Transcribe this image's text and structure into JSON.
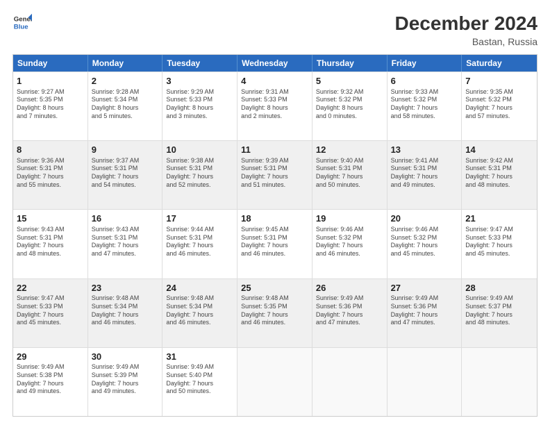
{
  "header": {
    "logo_line1": "General",
    "logo_line2": "Blue",
    "month": "December 2024",
    "location": "Bastan, Russia"
  },
  "weekdays": [
    "Sunday",
    "Monday",
    "Tuesday",
    "Wednesday",
    "Thursday",
    "Friday",
    "Saturday"
  ],
  "rows": [
    [
      {
        "day": "1",
        "lines": [
          "Sunrise: 9:27 AM",
          "Sunset: 5:35 PM",
          "Daylight: 8 hours",
          "and 7 minutes."
        ],
        "shade": false
      },
      {
        "day": "2",
        "lines": [
          "Sunrise: 9:28 AM",
          "Sunset: 5:34 PM",
          "Daylight: 8 hours",
          "and 5 minutes."
        ],
        "shade": false
      },
      {
        "day": "3",
        "lines": [
          "Sunrise: 9:29 AM",
          "Sunset: 5:33 PM",
          "Daylight: 8 hours",
          "and 3 minutes."
        ],
        "shade": false
      },
      {
        "day": "4",
        "lines": [
          "Sunrise: 9:31 AM",
          "Sunset: 5:33 PM",
          "Daylight: 8 hours",
          "and 2 minutes."
        ],
        "shade": false
      },
      {
        "day": "5",
        "lines": [
          "Sunrise: 9:32 AM",
          "Sunset: 5:32 PM",
          "Daylight: 8 hours",
          "and 0 minutes."
        ],
        "shade": false
      },
      {
        "day": "6",
        "lines": [
          "Sunrise: 9:33 AM",
          "Sunset: 5:32 PM",
          "Daylight: 7 hours",
          "and 58 minutes."
        ],
        "shade": false
      },
      {
        "day": "7",
        "lines": [
          "Sunrise: 9:35 AM",
          "Sunset: 5:32 PM",
          "Daylight: 7 hours",
          "and 57 minutes."
        ],
        "shade": false
      }
    ],
    [
      {
        "day": "8",
        "lines": [
          "Sunrise: 9:36 AM",
          "Sunset: 5:31 PM",
          "Daylight: 7 hours",
          "and 55 minutes."
        ],
        "shade": true
      },
      {
        "day": "9",
        "lines": [
          "Sunrise: 9:37 AM",
          "Sunset: 5:31 PM",
          "Daylight: 7 hours",
          "and 54 minutes."
        ],
        "shade": true
      },
      {
        "day": "10",
        "lines": [
          "Sunrise: 9:38 AM",
          "Sunset: 5:31 PM",
          "Daylight: 7 hours",
          "and 52 minutes."
        ],
        "shade": true
      },
      {
        "day": "11",
        "lines": [
          "Sunrise: 9:39 AM",
          "Sunset: 5:31 PM",
          "Daylight: 7 hours",
          "and 51 minutes."
        ],
        "shade": true
      },
      {
        "day": "12",
        "lines": [
          "Sunrise: 9:40 AM",
          "Sunset: 5:31 PM",
          "Daylight: 7 hours",
          "and 50 minutes."
        ],
        "shade": true
      },
      {
        "day": "13",
        "lines": [
          "Sunrise: 9:41 AM",
          "Sunset: 5:31 PM",
          "Daylight: 7 hours",
          "and 49 minutes."
        ],
        "shade": true
      },
      {
        "day": "14",
        "lines": [
          "Sunrise: 9:42 AM",
          "Sunset: 5:31 PM",
          "Daylight: 7 hours",
          "and 48 minutes."
        ],
        "shade": true
      }
    ],
    [
      {
        "day": "15",
        "lines": [
          "Sunrise: 9:43 AM",
          "Sunset: 5:31 PM",
          "Daylight: 7 hours",
          "and 48 minutes."
        ],
        "shade": false
      },
      {
        "day": "16",
        "lines": [
          "Sunrise: 9:43 AM",
          "Sunset: 5:31 PM",
          "Daylight: 7 hours",
          "and 47 minutes."
        ],
        "shade": false
      },
      {
        "day": "17",
        "lines": [
          "Sunrise: 9:44 AM",
          "Sunset: 5:31 PM",
          "Daylight: 7 hours",
          "and 46 minutes."
        ],
        "shade": false
      },
      {
        "day": "18",
        "lines": [
          "Sunrise: 9:45 AM",
          "Sunset: 5:31 PM",
          "Daylight: 7 hours",
          "and 46 minutes."
        ],
        "shade": false
      },
      {
        "day": "19",
        "lines": [
          "Sunrise: 9:46 AM",
          "Sunset: 5:32 PM",
          "Daylight: 7 hours",
          "and 46 minutes."
        ],
        "shade": false
      },
      {
        "day": "20",
        "lines": [
          "Sunrise: 9:46 AM",
          "Sunset: 5:32 PM",
          "Daylight: 7 hours",
          "and 45 minutes."
        ],
        "shade": false
      },
      {
        "day": "21",
        "lines": [
          "Sunrise: 9:47 AM",
          "Sunset: 5:33 PM",
          "Daylight: 7 hours",
          "and 45 minutes."
        ],
        "shade": false
      }
    ],
    [
      {
        "day": "22",
        "lines": [
          "Sunrise: 9:47 AM",
          "Sunset: 5:33 PM",
          "Daylight: 7 hours",
          "and 45 minutes."
        ],
        "shade": true
      },
      {
        "day": "23",
        "lines": [
          "Sunrise: 9:48 AM",
          "Sunset: 5:34 PM",
          "Daylight: 7 hours",
          "and 46 minutes."
        ],
        "shade": true
      },
      {
        "day": "24",
        "lines": [
          "Sunrise: 9:48 AM",
          "Sunset: 5:34 PM",
          "Daylight: 7 hours",
          "and 46 minutes."
        ],
        "shade": true
      },
      {
        "day": "25",
        "lines": [
          "Sunrise: 9:48 AM",
          "Sunset: 5:35 PM",
          "Daylight: 7 hours",
          "and 46 minutes."
        ],
        "shade": true
      },
      {
        "day": "26",
        "lines": [
          "Sunrise: 9:49 AM",
          "Sunset: 5:36 PM",
          "Daylight: 7 hours",
          "and 47 minutes."
        ],
        "shade": true
      },
      {
        "day": "27",
        "lines": [
          "Sunrise: 9:49 AM",
          "Sunset: 5:36 PM",
          "Daylight: 7 hours",
          "and 47 minutes."
        ],
        "shade": true
      },
      {
        "day": "28",
        "lines": [
          "Sunrise: 9:49 AM",
          "Sunset: 5:37 PM",
          "Daylight: 7 hours",
          "and 48 minutes."
        ],
        "shade": true
      }
    ],
    [
      {
        "day": "29",
        "lines": [
          "Sunrise: 9:49 AM",
          "Sunset: 5:38 PM",
          "Daylight: 7 hours",
          "and 49 minutes."
        ],
        "shade": false
      },
      {
        "day": "30",
        "lines": [
          "Sunrise: 9:49 AM",
          "Sunset: 5:39 PM",
          "Daylight: 7 hours",
          "and 49 minutes."
        ],
        "shade": false
      },
      {
        "day": "31",
        "lines": [
          "Sunrise: 9:49 AM",
          "Sunset: 5:40 PM",
          "Daylight: 7 hours",
          "and 50 minutes."
        ],
        "shade": false
      },
      {
        "day": "",
        "lines": [],
        "shade": false,
        "empty": true
      },
      {
        "day": "",
        "lines": [],
        "shade": false,
        "empty": true
      },
      {
        "day": "",
        "lines": [],
        "shade": false,
        "empty": true
      },
      {
        "day": "",
        "lines": [],
        "shade": false,
        "empty": true
      }
    ]
  ]
}
